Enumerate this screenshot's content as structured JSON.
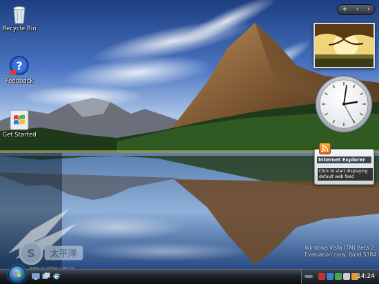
{
  "desktop_icons": [
    {
      "label": "Recycle Bin",
      "icon": "recycle-bin-icon"
    },
    {
      "label": "Feedback",
      "icon": "feedback-icon"
    },
    {
      "label": "Get Started",
      "icon": "windows-flag-icon"
    }
  ],
  "sidebar": {
    "controls": {
      "add": "+",
      "prev": "‹",
      "next": "›"
    },
    "feed_gadget": {
      "title": "Internet Explorer",
      "body": "Click to start displaying default web feed"
    }
  },
  "watermark": {
    "line1": "Windows Vista (TM) Beta 2",
    "line2": "Evaluation copy. Build 5384"
  },
  "site_logo": {
    "text": "太平洋",
    "url_text": "www.pconline.com.cn"
  },
  "taskbar": {
    "clock": "14:24"
  },
  "colors": {
    "accent": "#3a8fd0",
    "taskbar": "#1d2228",
    "rss": "#e0620b"
  }
}
